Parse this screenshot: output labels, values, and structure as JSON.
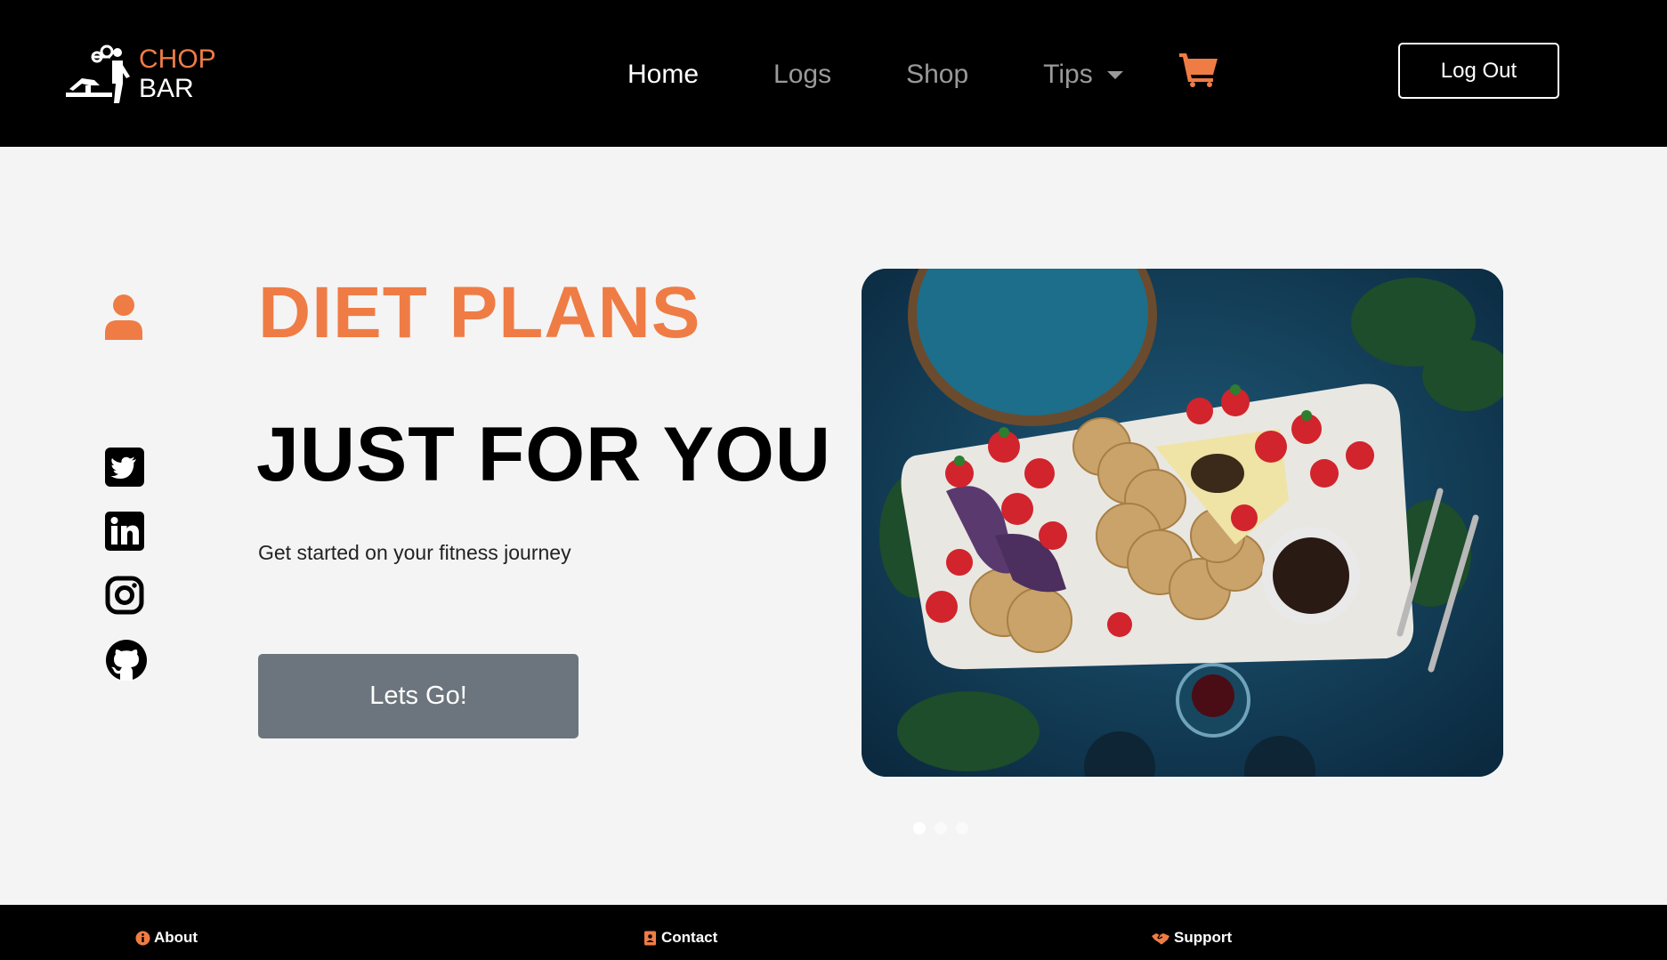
{
  "colors": {
    "accent": "#ef7c45",
    "header_bg": "#000000",
    "page_bg": "#f4f4f4",
    "button_gray": "#6c757d"
  },
  "brand": {
    "line1": "CHOP",
    "line2": "BAR",
    "icon": "lifter-logo-icon"
  },
  "nav": {
    "items": [
      {
        "label": "Home",
        "active": true
      },
      {
        "label": "Logs",
        "active": false
      },
      {
        "label": "Shop",
        "active": false
      },
      {
        "label": "Tips",
        "active": false,
        "dropdown": true
      }
    ],
    "cart_icon": "shopping-cart-icon",
    "logout_label": "Log Out"
  },
  "sidebar": {
    "icons": [
      "user-icon",
      "twitter-icon",
      "linkedin-icon",
      "instagram-icon",
      "github-icon"
    ]
  },
  "hero": {
    "title": "DIET PLANS",
    "subtitle": "JUST FOR YOU",
    "tagline": "Get started on your fitness journey",
    "cta_label": "Lets Go!"
  },
  "carousel": {
    "slide_count": 3,
    "active_index": 0
  },
  "footer": {
    "links": [
      {
        "label": "About",
        "icon": "info-circle-icon"
      },
      {
        "label": "Contact",
        "icon": "contact-card-icon"
      },
      {
        "label": "Support",
        "icon": "handshake-icon"
      }
    ]
  }
}
